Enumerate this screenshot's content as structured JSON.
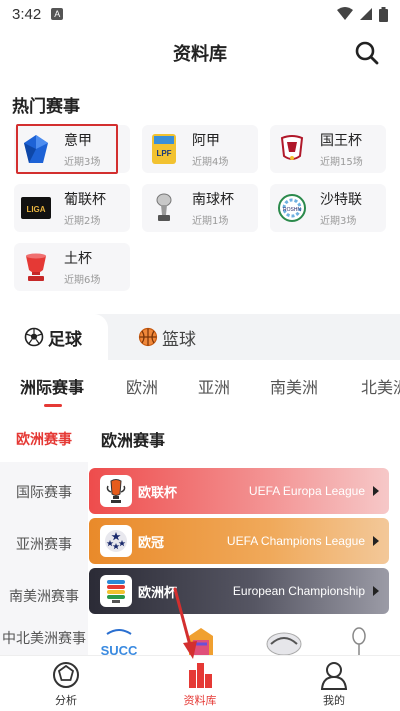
{
  "status_bar": {
    "time": "3:42",
    "notif": "A"
  },
  "header": {
    "title": "资料库"
  },
  "hot": {
    "title": "热门赛事",
    "items": [
      {
        "name": "意甲",
        "recent": "近期3场"
      },
      {
        "name": "阿甲",
        "recent": "近期4场"
      },
      {
        "name": "国王杯",
        "recent": "近期15场"
      },
      {
        "name": "葡联杯",
        "recent": "近期2场"
      },
      {
        "name": "南球杯",
        "recent": "近期1场"
      },
      {
        "name": "沙特联",
        "recent": "近期3场"
      },
      {
        "name": "土杯",
        "recent": "近期6场"
      }
    ],
    "logo_texts": {
      "lpf": "LPF",
      "liga": "LIGA",
      "saudi": "ROSHN"
    }
  },
  "sport_tabs": [
    {
      "label": "足球",
      "active": true
    },
    {
      "label": "篮球",
      "active": false
    }
  ],
  "region_tabs": [
    {
      "label": "洲际赛事",
      "active": true
    },
    {
      "label": "欧洲",
      "active": false
    },
    {
      "label": "亚洲",
      "active": false
    },
    {
      "label": "南美洲",
      "active": false
    },
    {
      "label": "北美洲",
      "active": false
    }
  ],
  "left_nav": [
    {
      "label": "欧洲赛事",
      "active": true
    },
    {
      "label": "国际赛事",
      "active": false
    },
    {
      "label": "亚洲赛事",
      "active": false
    },
    {
      "label": "南美洲赛事",
      "active": false
    },
    {
      "label": "中北美洲赛事",
      "active": false
    }
  ],
  "content": {
    "section_title": "欧洲赛事",
    "competitions": [
      {
        "cn": "欧联杯",
        "en": "UEFA Europa League"
      },
      {
        "cn": "欧冠",
        "en": "UEFA Champions League"
      },
      {
        "cn": "欧洲杯",
        "en": "European Championship"
      }
    ],
    "strip_logo_text": "SUCC"
  },
  "bottom_nav": [
    {
      "label": "分析",
      "active": false
    },
    {
      "label": "资料库",
      "active": true
    },
    {
      "label": "我的",
      "active": false
    }
  ],
  "colors": {
    "accent": "#e53935",
    "highlight": "#d32f2f"
  }
}
